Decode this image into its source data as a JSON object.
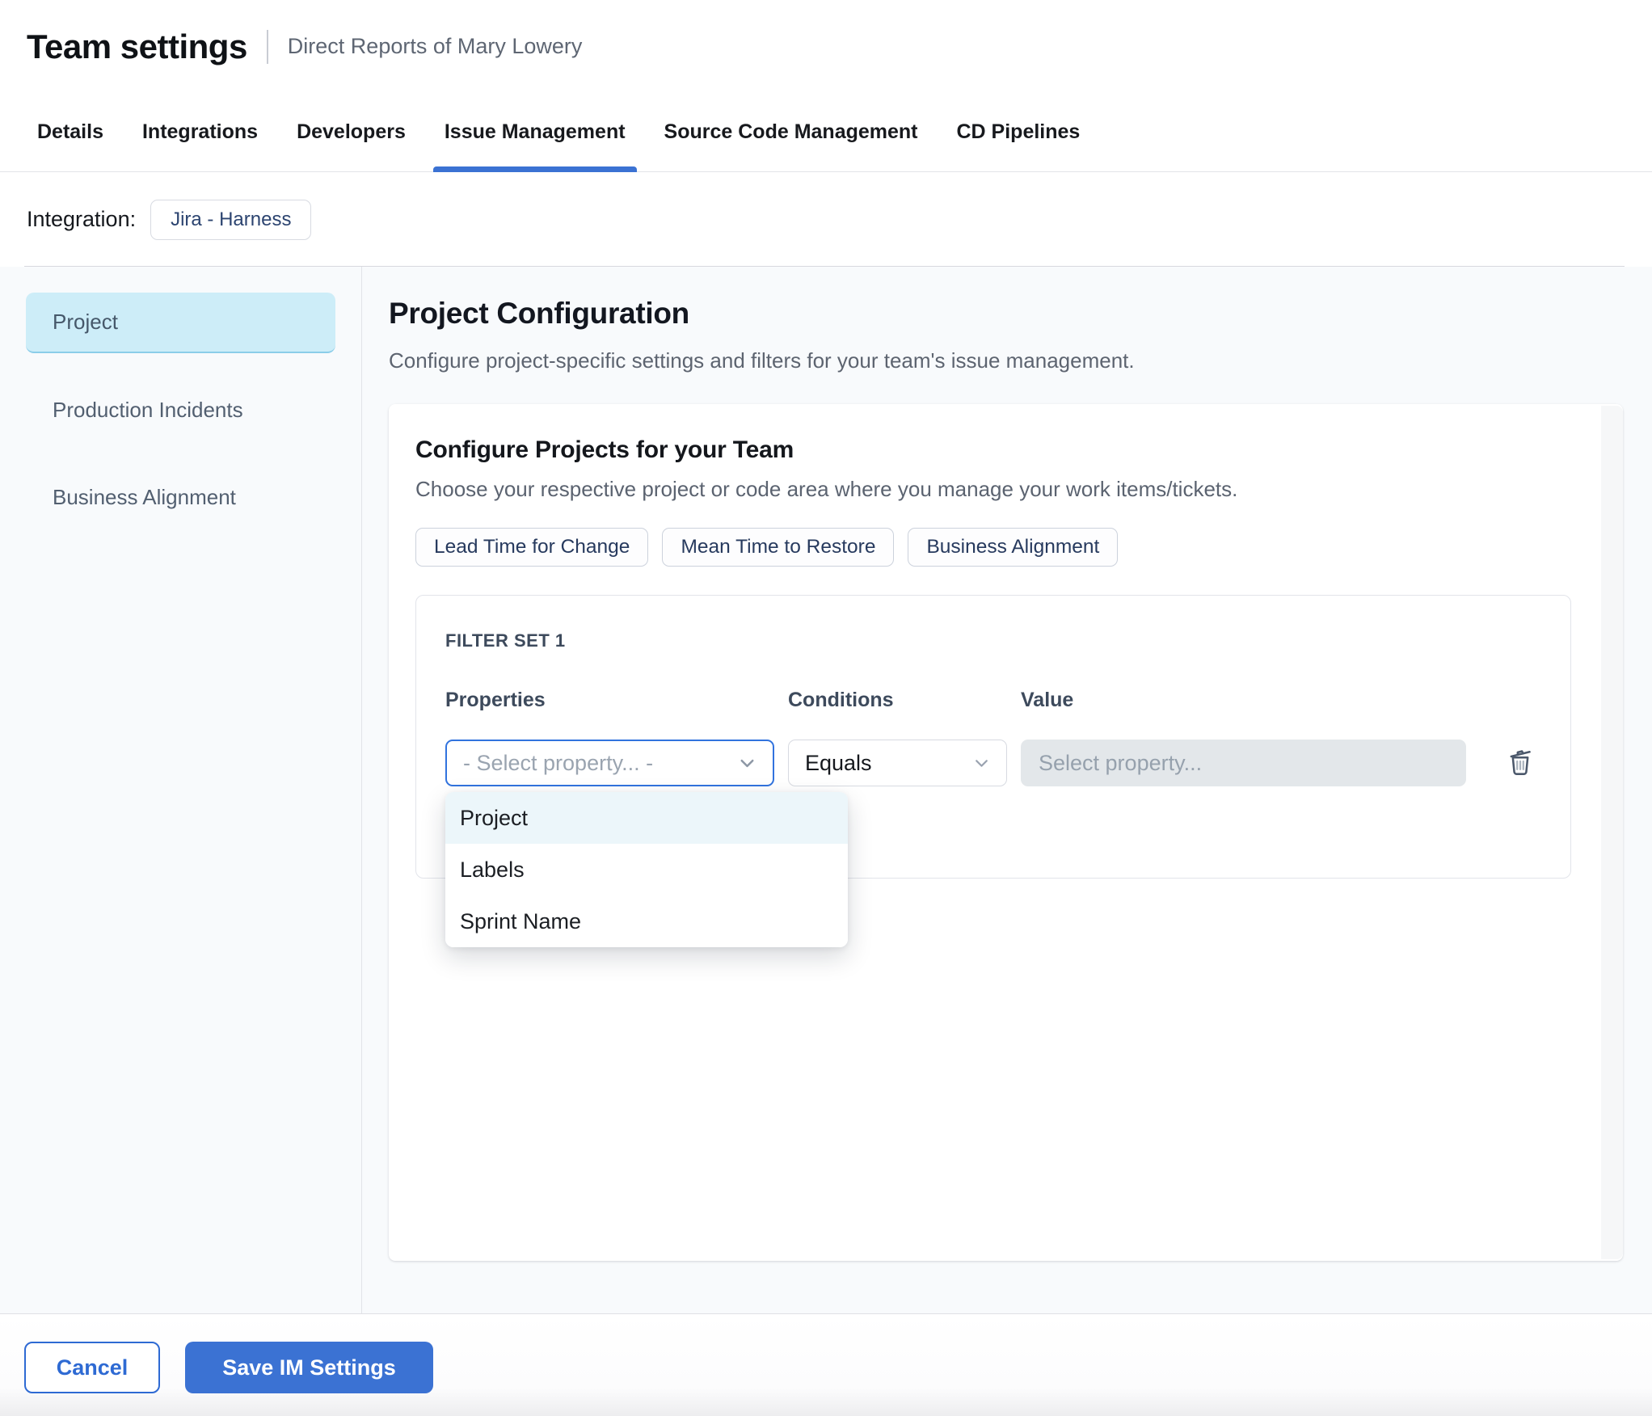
{
  "header": {
    "title": "Team settings",
    "subtitle": "Direct Reports of Mary Lowery"
  },
  "tabs": {
    "items": [
      {
        "label": "Details"
      },
      {
        "label": "Integrations"
      },
      {
        "label": "Developers"
      },
      {
        "label": "Issue Management"
      },
      {
        "label": "Source Code Management"
      },
      {
        "label": "CD Pipelines"
      }
    ],
    "active": "Issue Management"
  },
  "integration": {
    "label": "Integration:",
    "badge": "Jira - Harness"
  },
  "sidebar": {
    "items": [
      {
        "label": "Project"
      },
      {
        "label": "Production Incidents"
      },
      {
        "label": "Business Alignment"
      }
    ],
    "selected": "Project"
  },
  "main": {
    "title": "Project Configuration",
    "description": "Configure project-specific settings and filters for your team's issue management."
  },
  "card": {
    "title": "Configure Projects for your Team",
    "subtitle": "Choose your respective project or code area where you manage your work items/tickets.",
    "chips": [
      {
        "label": "Lead Time for Change"
      },
      {
        "label": "Mean Time to Restore"
      },
      {
        "label": "Business Alignment"
      }
    ]
  },
  "filter_set": {
    "title": "FILTER SET 1",
    "properties_label": "Properties",
    "conditions_label": "Conditions",
    "value_label": "Value",
    "property_placeholder": "- Select property... -",
    "condition_value": "Equals",
    "value_placeholder": "Select property...",
    "options": [
      {
        "label": "Project"
      },
      {
        "label": "Labels"
      },
      {
        "label": "Sprint Name"
      }
    ],
    "highlighted_option": "Project"
  },
  "footer": {
    "cancel_label": "Cancel",
    "save_label": "Save IM Settings"
  },
  "colors": {
    "accent_blue": "#3b72d3",
    "focus_blue": "#3173de",
    "selected_sidebar_bg": "#cdedf8",
    "selected_sidebar_border": "#8bcde9",
    "dropdown_highlight_bg": "#ecf6fa",
    "content_bg": "#f8fafc",
    "badge_text": "#2c4470"
  }
}
